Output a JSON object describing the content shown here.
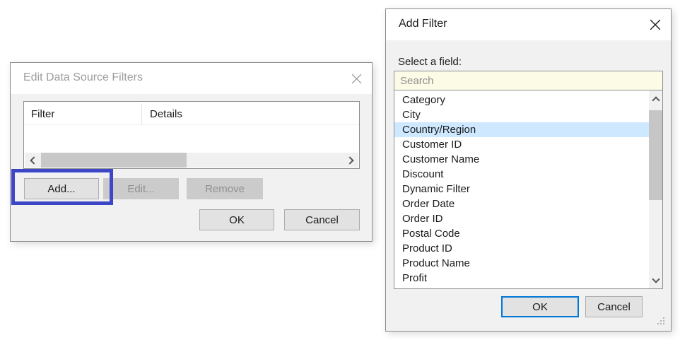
{
  "colors": {
    "selection_bg": "#cde8ff",
    "search_bg": "#fbfbe6",
    "focus_blue": "#0078d7",
    "annotation_blue": "#3e46c8",
    "disabled_button_bg": "#cbcbcb"
  },
  "edit_filters_dialog": {
    "title": "Edit Data Source Filters",
    "table": {
      "columns": [
        "Filter",
        "Details"
      ],
      "rows": []
    },
    "add_button": "Add...",
    "edit_button": "Edit...",
    "remove_button": "Remove",
    "ok_button": "OK",
    "cancel_button": "Cancel"
  },
  "add_filter_dialog": {
    "title": "Add Filter",
    "select_label": "Select a field:",
    "search_placeholder": "Search",
    "search_value": "",
    "fields": [
      "Category",
      "City",
      "Country/Region",
      "Customer ID",
      "Customer Name",
      "Discount",
      "Dynamic Filter",
      "Order Date",
      "Order ID",
      "Postal Code",
      "Product ID",
      "Product Name",
      "Profit"
    ],
    "selected_field": "Country/Region",
    "ok_button": "OK",
    "cancel_button": "Cancel"
  }
}
